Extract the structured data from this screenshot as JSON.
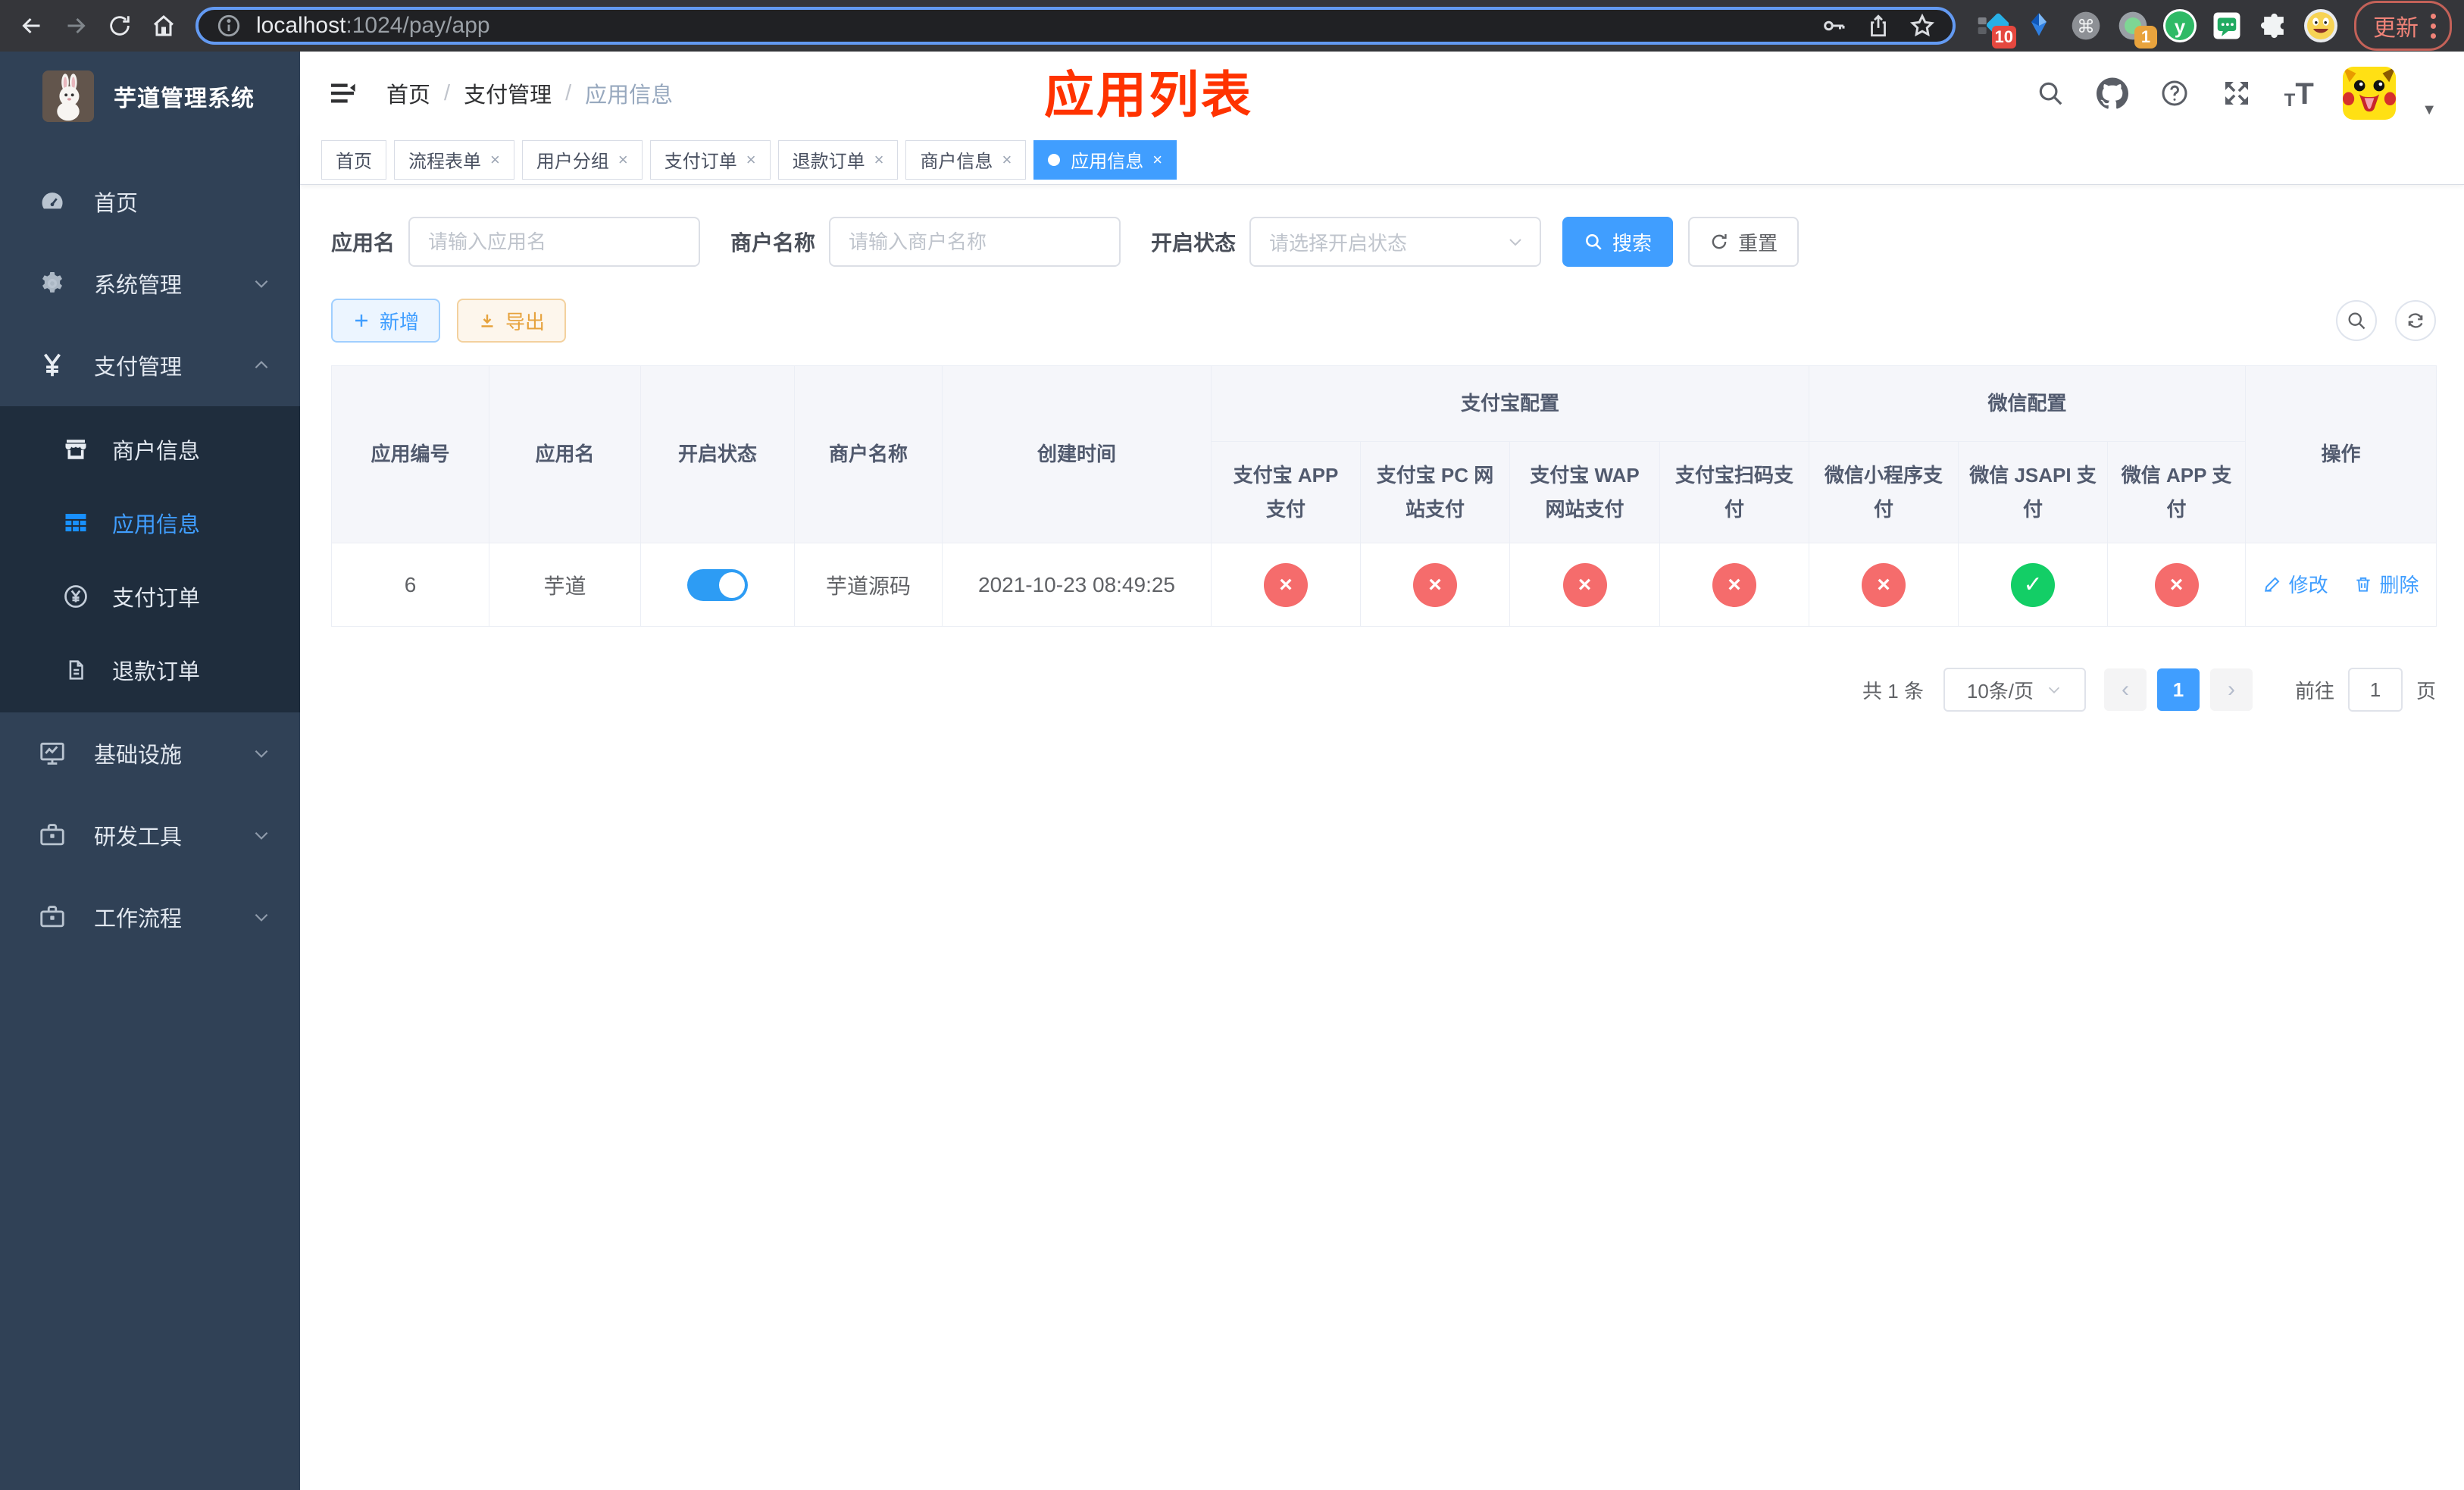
{
  "browser": {
    "url_host": "localhost",
    "url_rest": ":1024/pay/app",
    "update_label": "更新",
    "badge_blue": "10",
    "badge_orange": "1"
  },
  "sidebar": {
    "title": "芋道管理系统",
    "items": [
      {
        "label": "首页"
      },
      {
        "label": "系统管理"
      },
      {
        "label": "支付管理"
      },
      {
        "label": "基础设施"
      },
      {
        "label": "研发工具"
      },
      {
        "label": "工作流程"
      }
    ],
    "submenu": [
      {
        "label": "商户信息"
      },
      {
        "label": "应用信息"
      },
      {
        "label": "支付订单"
      },
      {
        "label": "退款订单"
      }
    ]
  },
  "header": {
    "breadcrumb": [
      "首页",
      "支付管理",
      "应用信息"
    ],
    "annotation": "应用列表"
  },
  "tabs": [
    {
      "label": "首页"
    },
    {
      "label": "流程表单"
    },
    {
      "label": "用户分组"
    },
    {
      "label": "支付订单"
    },
    {
      "label": "退款订单"
    },
    {
      "label": "商户信息"
    },
    {
      "label": "应用信息"
    }
  ],
  "filters": {
    "app_name_label": "应用名",
    "app_name_placeholder": "请输入应用名",
    "merchant_label": "商户名称",
    "merchant_placeholder": "请输入商户名称",
    "status_label": "开启状态",
    "status_placeholder": "请选择开启状态",
    "search_label": "搜索",
    "reset_label": "重置"
  },
  "toolbar": {
    "add_label": "新增",
    "export_label": "导出"
  },
  "table": {
    "col_app_id": "应用编号",
    "col_app_name": "应用名",
    "col_status": "开启状态",
    "col_merchant": "商户名称",
    "col_created": "创建时间",
    "group_alipay": "支付宝配置",
    "group_wechat": "微信配置",
    "alipay_cols": [
      "支付宝 APP 支付",
      "支付宝 PC 网站支付",
      "支付宝 WAP 网站支付",
      "支付宝扫码支付"
    ],
    "wechat_cols": [
      "微信小程序支付",
      "微信 JSAPI 支付",
      "微信 APP 支付"
    ],
    "col_ops": "操作",
    "rows": [
      {
        "app_id": "6",
        "app_name": "芋道",
        "enabled": true,
        "merchant": "芋道源码",
        "created": "2021-10-23 08:49:25",
        "pay_statuses": [
          "no",
          "no",
          "no",
          "no",
          "no",
          "yes",
          "no"
        ],
        "edit_label": "修改",
        "delete_label": "删除"
      }
    ]
  },
  "pagination": {
    "total": "共 1 条",
    "page_size": "10条/页",
    "page": "1",
    "goto_label": "前往",
    "goto_value": "1",
    "unit_label": "页"
  },
  "colors": {
    "accent": "#409eff",
    "danger": "#f56c6c",
    "success": "#13ce66",
    "warning": "#e6a23c",
    "sidebar": "#304156",
    "annotation": "#ff3300"
  }
}
